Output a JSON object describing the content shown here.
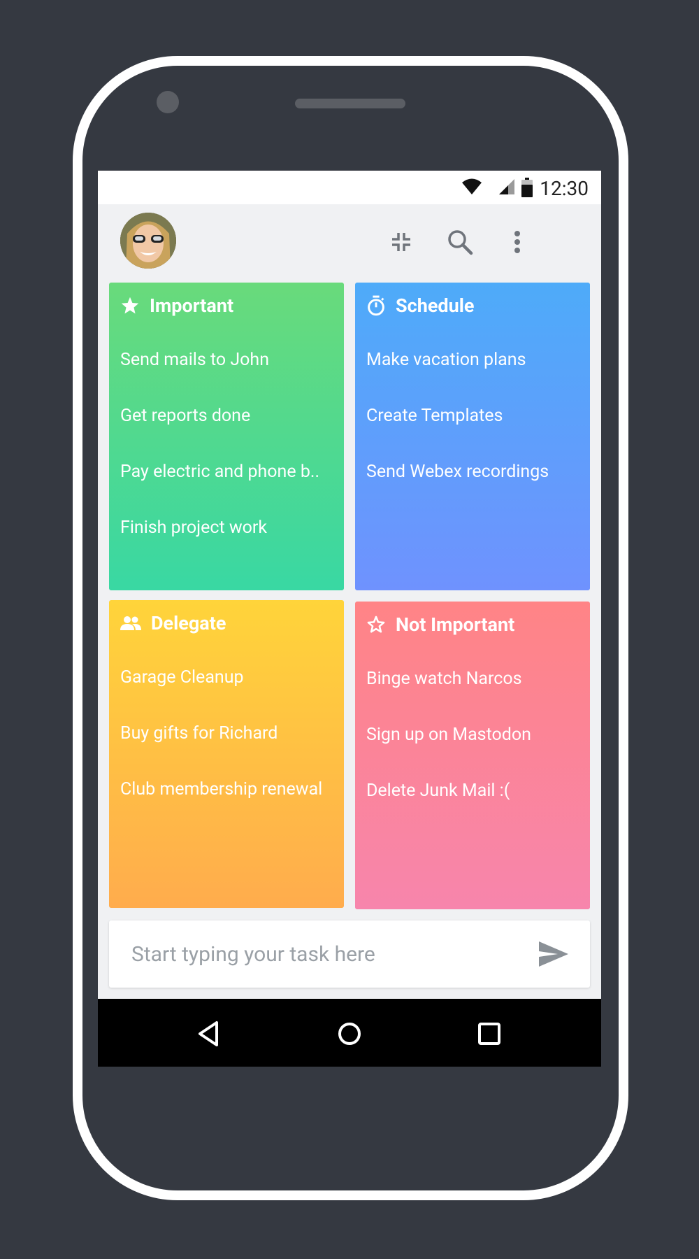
{
  "status_bar": {
    "time": "12:30",
    "icons": [
      "wifi-icon",
      "cell-signal-icon",
      "battery-icon"
    ]
  },
  "app_bar": {
    "avatar": "user-avatar",
    "actions": [
      {
        "name": "collapse-icon"
      },
      {
        "name": "search-icon"
      },
      {
        "name": "more-vert-icon"
      }
    ]
  },
  "quadrants": [
    {
      "id": "important",
      "title": "Important",
      "icon": "star-filled-icon",
      "color_top": "#69da7b",
      "color_bottom": "#39d8a3",
      "items": [
        "Send mails to John",
        "Get reports done",
        "Pay electric and phone b..",
        "Finish project work"
      ]
    },
    {
      "id": "schedule",
      "title": "Schedule",
      "icon": "timer-icon",
      "color_top": "#4eabf9",
      "color_bottom": "#6f92fe",
      "items": [
        "Make vacation plans",
        "Create Templates",
        "Send Webex recordings"
      ]
    },
    {
      "id": "delegate",
      "title": "Delegate",
      "icon": "people-icon",
      "color_top": "#ffd43a",
      "color_bottom": "#ffac4d",
      "items": [
        "Garage Cleanup",
        "Buy gifts for Richard",
        "Club membership renewal"
      ]
    },
    {
      "id": "not-important",
      "title": "Not Important",
      "icon": "star-outline-icon",
      "color_top": "#ff8486",
      "color_bottom": "#f785ac",
      "items": [
        "Binge watch Narcos",
        "Sign up on Mastodon",
        "Delete Junk Mail :("
      ]
    }
  ],
  "task_input": {
    "placeholder": "Start typing your task here",
    "value": "",
    "send_icon": "send-icon"
  },
  "nav_bar": {
    "buttons": [
      "back-icon",
      "home-icon",
      "recents-icon"
    ]
  },
  "colors": {
    "background": "#353941",
    "screen": "#f0f1f3",
    "icon_gray": "#6f747b"
  }
}
